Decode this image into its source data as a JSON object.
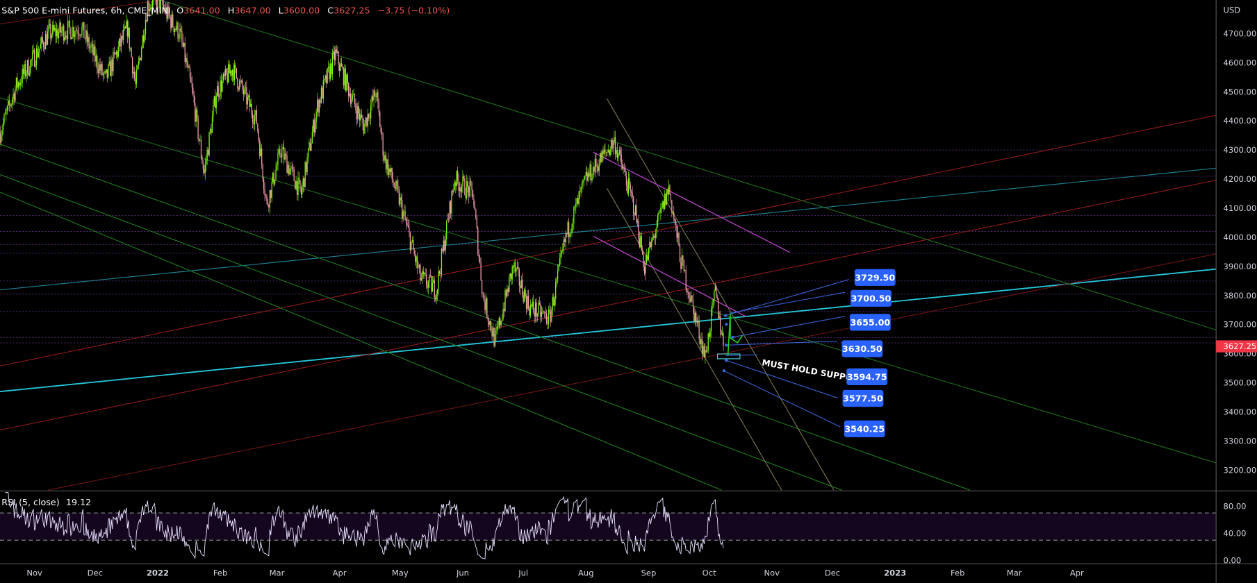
{
  "header": {
    "symbol": "S&P 500 E-mini Futures, 6h, CME_MINI",
    "open_label": "O",
    "open": "3641.00",
    "high_label": "H",
    "high": "3647.00",
    "low_label": "L",
    "low": "3600.00",
    "close_label": "C",
    "close": "3627.25",
    "change": "−3.75 (−0.10%)"
  },
  "colors": {
    "up": "#26a69a",
    "candle_up": "#7cfc00",
    "candle_down": "#f7a1b0",
    "down_text": "#ef5350",
    "label_bg": "#2962ff",
    "last_price_bg": "#f23645",
    "rsi_line": "#e8e0ff",
    "rsi_band": "#14061f"
  },
  "price_axis": {
    "currency": "USD",
    "last_price": "3627.25"
  },
  "rsi": {
    "title": "RSI (5, close)",
    "value": "19.12"
  },
  "annotations": {
    "note": "MUST HOLD SUPPORT",
    "levels": [
      "3729.50",
      "3700.50",
      "3655.00",
      "3630.50",
      "3594.75",
      "3577.50",
      "3540.25"
    ]
  },
  "chart_data": {
    "type": "candlestick",
    "title": "S&P 500 E-mini Futures, 6h, CME_MINI",
    "x_unit": "days since 2021-10-01",
    "ylabel": "USD",
    "ylim": [
      3130,
      4830
    ],
    "yticks": [
      "4700.00",
      "4600.00",
      "4500.00",
      "4400.00",
      "4300.00",
      "4200.00",
      "4100.00",
      "4000.00",
      "3900.00",
      "3800.00",
      "3700.00",
      "3600.00",
      "3500.00",
      "3400.00",
      "3300.00",
      "3200.00"
    ],
    "xticks": [
      {
        "label": "Nov",
        "day": 31
      },
      {
        "label": "Dec",
        "day": 61
      },
      {
        "label": "2022",
        "day": 92
      },
      {
        "label": "Feb",
        "day": 123
      },
      {
        "label": "Mar",
        "day": 151
      },
      {
        "label": "Apr",
        "day": 182
      },
      {
        "label": "May",
        "day": 212
      },
      {
        "label": "Jun",
        "day": 243
      },
      {
        "label": "Jul",
        "day": 273
      },
      {
        "label": "Aug",
        "day": 304
      },
      {
        "label": "Sep",
        "day": 335
      },
      {
        "label": "Oct",
        "day": 365
      },
      {
        "label": "Nov",
        "day": 396
      },
      {
        "label": "Dec",
        "day": 426
      },
      {
        "label": "2023",
        "day": 457
      },
      {
        "label": "Feb",
        "day": 488
      },
      {
        "label": "Mar",
        "day": 516
      },
      {
        "label": "Apr",
        "day": 547
      }
    ],
    "price_path": [
      [
        14,
        4360
      ],
      [
        22,
        4520
      ],
      [
        38,
        4700
      ],
      [
        54,
        4720
      ],
      [
        66,
        4540
      ],
      [
        77,
        4720
      ],
      [
        81,
        4520
      ],
      [
        87,
        4800
      ],
      [
        93,
        4810
      ],
      [
        99,
        4740
      ],
      [
        103,
        4700
      ],
      [
        109,
        4500
      ],
      [
        115,
        4220
      ],
      [
        121,
        4500
      ],
      [
        129,
        4580
      ],
      [
        141,
        4400
      ],
      [
        146,
        4110
      ],
      [
        153,
        4300
      ],
      [
        163,
        4150
      ],
      [
        171,
        4450
      ],
      [
        180,
        4630
      ],
      [
        187,
        4500
      ],
      [
        194,
        4380
      ],
      [
        200,
        4500
      ],
      [
        204,
        4280
      ],
      [
        212,
        4120
      ],
      [
        222,
        3860
      ],
      [
        230,
        3820
      ],
      [
        239,
        4200
      ],
      [
        248,
        4150
      ],
      [
        253,
        3800
      ],
      [
        259,
        3640
      ],
      [
        268,
        3900
      ],
      [
        276,
        3760
      ],
      [
        286,
        3720
      ],
      [
        294,
        4000
      ],
      [
        304,
        4200
      ],
      [
        318,
        4330
      ],
      [
        328,
        4100
      ],
      [
        333,
        3900
      ],
      [
        345,
        4170
      ],
      [
        351,
        3920
      ],
      [
        359,
        3700
      ],
      [
        363,
        3590
      ],
      [
        368,
        3810
      ],
      [
        371,
        3680
      ],
      [
        372,
        3627.25
      ]
    ],
    "rsi_pane": {
      "yticks": [
        "80.00",
        "40.00",
        "0.00"
      ],
      "upper_band": 70,
      "lower_band": 30,
      "ylim": [
        0,
        100
      ]
    }
  }
}
